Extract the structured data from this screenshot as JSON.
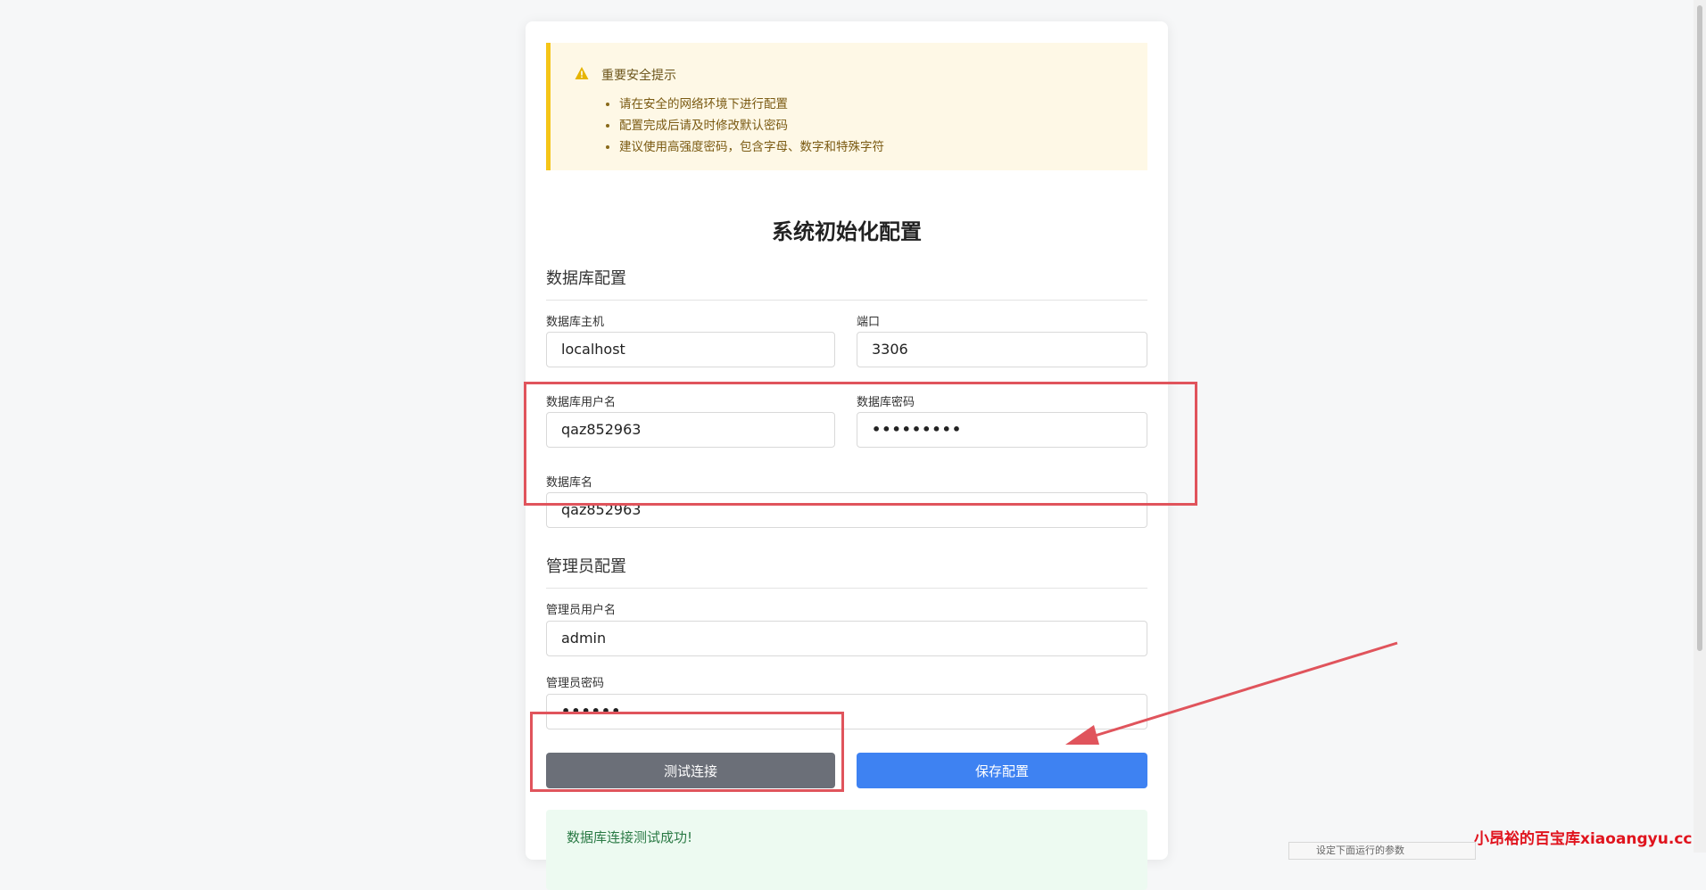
{
  "alert": {
    "title": "重要安全提示",
    "items": [
      "请在安全的网络环境下进行配置",
      "配置完成后请及时修改默认密码",
      "建议使用高强度密码，包含字母、数字和特殊字符"
    ]
  },
  "page_title": "系统初始化配置",
  "database": {
    "section_title": "数据库配置",
    "host_label": "数据库主机",
    "host_value": "localhost",
    "port_label": "端口",
    "port_value": "3306",
    "user_label": "数据库用户名",
    "user_value": "qaz852963",
    "password_label": "数据库密码",
    "password_value": "•••••••••",
    "name_label": "数据库名",
    "name_value": "qaz852963"
  },
  "admin": {
    "section_title": "管理员配置",
    "username_label": "管理员用户名",
    "username_value": "admin",
    "password_label": "管理员密码",
    "password_value": "••••••"
  },
  "buttons": {
    "test": "测试连接",
    "save": "保存配置"
  },
  "success_message": "数据库连接测试成功!",
  "watermark": "小昂裕的百宝库xiaoangyu.cc",
  "tooltip_text": "设定下面运行的参数",
  "colors": {
    "warning_border": "#f5c518",
    "warning_bg": "#fef8e6",
    "primary": "#3e82f2",
    "secondary": "#6b6f78",
    "success_bg": "#edfaf1",
    "annotation": "#e0545c"
  }
}
